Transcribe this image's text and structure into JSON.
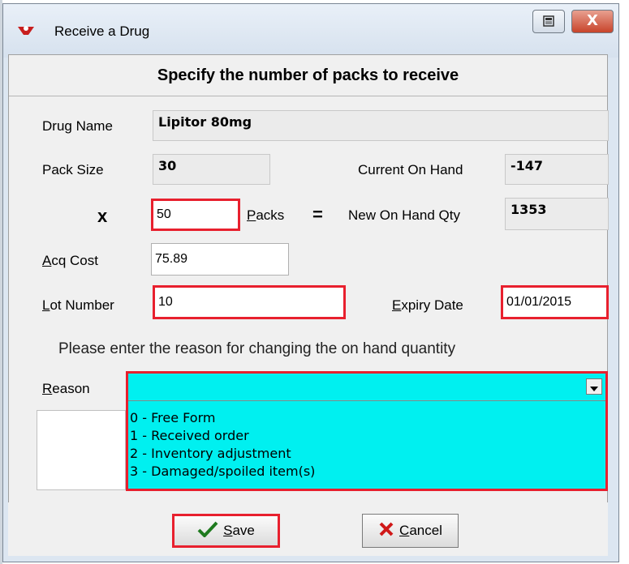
{
  "window": {
    "title": "Receive a Drug",
    "close_label": "X"
  },
  "header": "Specify the number of packs to receive",
  "fields": {
    "drug_name_label": "Drug Name",
    "drug_name": "Lipitor 80mg",
    "pack_size_label": "Pack Size",
    "pack_size": "30",
    "current_on_hand_label": "Current On Hand",
    "current_on_hand": "-147",
    "multiply_symbol": "x",
    "packs_value": "50",
    "packs_label_first": "P",
    "packs_label_rest": "acks",
    "equals_symbol": "=",
    "new_on_hand_label": "New On Hand Qty",
    "new_on_hand": "1353",
    "acq_cost_label_first": "A",
    "acq_cost_label_rest": "cq Cost",
    "acq_cost": "75.89",
    "lot_number_label_first": "L",
    "lot_number_label_rest": "ot Number",
    "lot_number": "10",
    "expiry_date_label_first": "E",
    "expiry_date_label_rest": "xpiry Date",
    "expiry_date": "01/01/2015"
  },
  "reason": {
    "prompt": "Please enter the reason for changing the on hand quantity",
    "label_first": "R",
    "label_rest": "eason",
    "selected": "",
    "options": [
      "0 - Free Form",
      "1 - Received order",
      "2 - Inventory adjustment",
      "3 - Damaged/spoiled item(s)"
    ]
  },
  "buttons": {
    "save_first": "S",
    "save_rest": "ave",
    "cancel_first": "C",
    "cancel_rest": "ancel"
  },
  "colors": {
    "highlight": "#e8202e",
    "dropdown_bg": "#00f0f0"
  },
  "icons": {
    "app": "drug-app-icon",
    "restore": "restore-icon",
    "close": "close-icon",
    "dropdown": "chevron-down-icon",
    "save": "checkmark-icon",
    "cancel": "x-icon"
  }
}
